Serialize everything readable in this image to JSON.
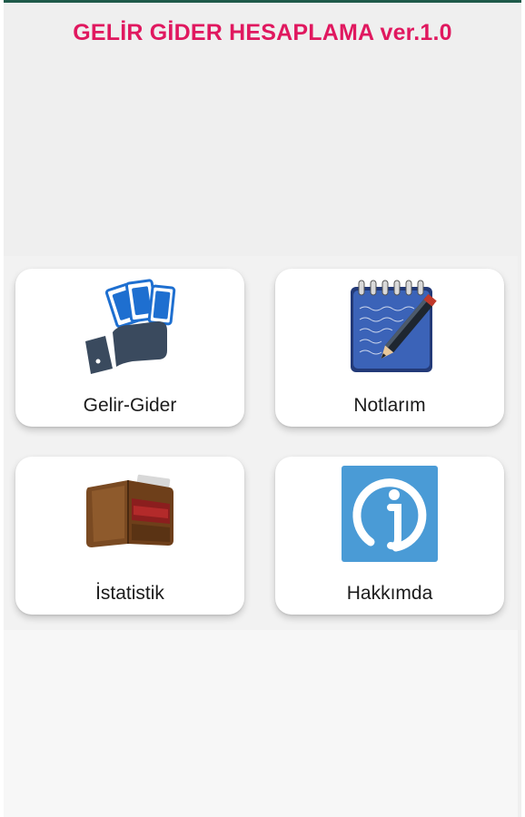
{
  "app": {
    "title": "GELİR GİDER HESAPLAMA ver.1.0"
  },
  "menu": {
    "items": [
      {
        "label": "Gelir-Gider",
        "icon": "hand-money-icon"
      },
      {
        "label": "Notlarım",
        "icon": "notepad-pen-icon"
      },
      {
        "label": "İstatistik",
        "icon": "wallet-icon"
      },
      {
        "label": "Hakkımda",
        "icon": "info-icon"
      }
    ]
  },
  "colors": {
    "title": "#e0185f",
    "background": "#efefef",
    "card": "#ffffff",
    "info_tile": "#4a9bd6",
    "top_bar": "#1f5a4a"
  }
}
